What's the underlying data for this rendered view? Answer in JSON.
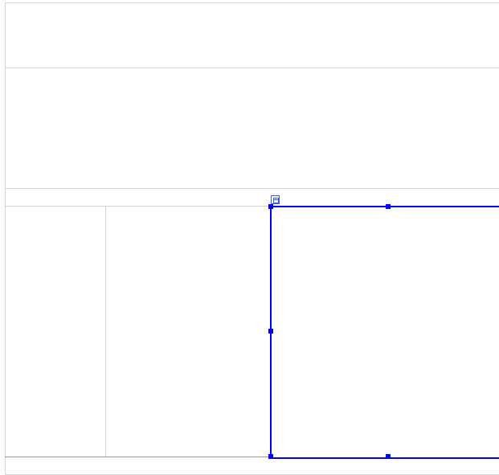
{
  "document": {
    "table": {
      "rows": [
        {
          "cells": [
            ""
          ]
        },
        {
          "cells": [
            ""
          ]
        },
        {
          "cells": [
            ""
          ]
        },
        {
          "cells": [
            "",
            "",
            ""
          ]
        },
        {
          "cells": [
            ""
          ]
        }
      ]
    },
    "selection": {
      "active": true,
      "color": "#0000ff"
    }
  },
  "colors": {
    "gridline": "#d4d4d4",
    "selection": "#0000ff"
  },
  "icons": {
    "move_handle": "table-move-icon"
  }
}
